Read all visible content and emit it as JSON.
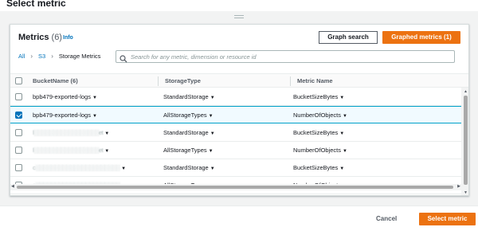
{
  "modal": {
    "title": "Select metric"
  },
  "panel": {
    "title": "Metrics",
    "count": "(6)",
    "info": "Info",
    "graph_search": "Graph search",
    "graphed_metrics": "Graphed metrics (1)"
  },
  "breadcrumb": {
    "items": [
      "All",
      "S3",
      "Storage Metrics"
    ]
  },
  "search": {
    "placeholder": "Search for any metric, dimension or resource id",
    "icon": "search-icon"
  },
  "table": {
    "headers": [
      "BucketName (6)",
      "StorageType",
      "Metric Name"
    ],
    "rows": [
      {
        "checked": false,
        "bucket": "bpb479-exported-logs",
        "storage": "StandardStorage",
        "metric": "BucketSizeBytes",
        "obscured": false
      },
      {
        "checked": true,
        "bucket": "bpb479-exported-logs",
        "storage": "AllStorageTypes",
        "metric": "NumberOfObjects",
        "obscured": false
      },
      {
        "checked": false,
        "bucket": "l░░░░░░░░░░░░░░░░░et",
        "storage": "StandardStorage",
        "metric": "BucketSizeBytes",
        "obscured": true
      },
      {
        "checked": false,
        "bucket": "l░░░░░░░░░░░░░░░░░et",
        "storage": "AllStorageTypes",
        "metric": "NumberOfObjects",
        "obscured": true
      },
      {
        "checked": false,
        "bucket": "c░░░░░░░░░░░░░░░░░░░░░░",
        "storage": "StandardStorage",
        "metric": "BucketSizeBytes",
        "obscured": true
      },
      {
        "checked": false,
        "bucket": "c░░░░░░░░░░░░░░░░░░░░░░",
        "storage": "AllStorageTypes",
        "metric": "NumberOfObjects",
        "obscured": true
      }
    ]
  },
  "footer": {
    "cancel": "Cancel",
    "select": "Select metric"
  },
  "colors": {
    "primary": "#ec7211",
    "link": "#0073bb",
    "selected_row": "#f1faff"
  }
}
